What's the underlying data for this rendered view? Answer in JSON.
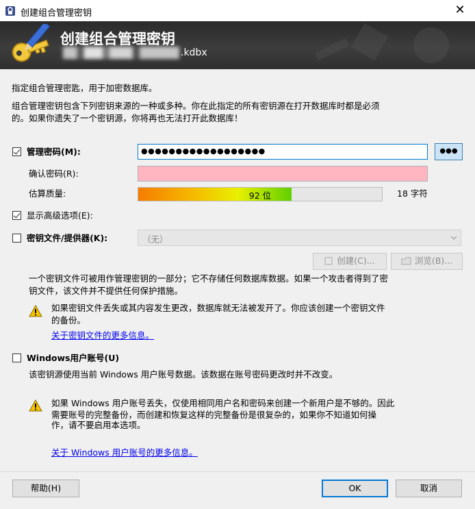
{
  "window": {
    "title": "创建组合管理密钥",
    "close_glyph": "✕"
  },
  "banner": {
    "heading": "创建组合管理密钥",
    "filename_suffix": ".kdbx"
  },
  "intro": {
    "line1": "指定组合管理密匙，用于加密数据库。",
    "line2a": "组合管理密钥包含下列密钥来源的一种或多种。你在此指定的所有密钥源在打开数据库时都是必须",
    "line2b": "的。如果你遗失了一个密钥源，你将再也无法打开此数据库！"
  },
  "master_password": {
    "label": "管理密码(M):",
    "checked": true,
    "value": "●●●●●●●●●●●●●●●●●●",
    "toggle_label": "●●●"
  },
  "confirm": {
    "label": "确认密码(R):",
    "value": ""
  },
  "quality": {
    "label": "估算质量:",
    "bar_text": "92 位",
    "fraction": 0.63,
    "chars": "18 字符"
  },
  "advanced": {
    "label": "显示高级选项(E):",
    "checked": true
  },
  "keyfile": {
    "label": "密钥文件/提供器(K):",
    "checked": false,
    "selected": "（无）",
    "create_label": "创建(C)...",
    "browse_label": "浏览(B)...",
    "desc_a": "一个密钥文件可被用作管理密钥的一部分；它不存储任何数据库数据。如果一个攻击者得到了密",
    "desc_b": "钥文件，该文件并不提供任何保护措施。",
    "warn_a": "如果密钥文件丢失或其内容发生更改，数据库就无法被发开了。你应该创建一个密钥文件",
    "warn_b": "的备份。",
    "link": "关于密钥文件的更多信息。"
  },
  "windows_account": {
    "label": "Windows用户账号(U)",
    "checked": false,
    "desc": "该密钥源使用当前 Windows 用户账号数据。该数据在账号密码更改时并不改变。",
    "warn_a": "如果 Windows 用户账号丢失，仅使用相同用户名和密码来创建一个新用户是不够的。因此",
    "warn_b": "需要账号的完整备份，而创建和恢复这样的完整备份是很复杂的，如果你不知道如何操",
    "warn_c": "作，请不要启用本选项。",
    "link": "关于 Windows 用户账号的更多信息。"
  },
  "footer": {
    "help": "帮助(H)",
    "ok": "OK",
    "cancel": "取消"
  }
}
